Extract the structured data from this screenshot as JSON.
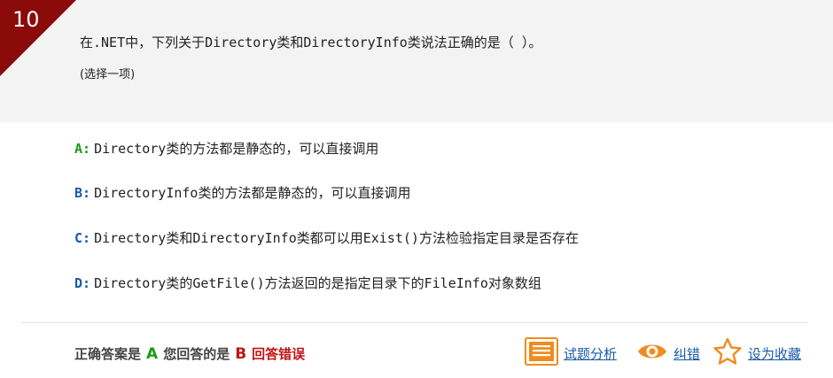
{
  "question": {
    "number": "10",
    "text": "在.NET中，下列关于Directory类和DirectoryInfo类说法正确的是（ ）。",
    "type": "(选择一项)"
  },
  "options": [
    {
      "key": "A:",
      "text": "Directory类的方法都是静态的，可以直接调用",
      "key_color": "#1a9a1a"
    },
    {
      "key": "B:",
      "text": "DirectoryInfo类的方法都是静态的，可以直接调用",
      "key_color": "#1a5aa8"
    },
    {
      "key": "C:",
      "text": "Directory类和DirectoryInfo类都可以用Exist()方法检验指定目录是否存在",
      "key_color": "#1a5aa8"
    },
    {
      "key": "D:",
      "text": "Directory类的GetFile()方法返回的是指定目录下的FileInfo对象数组",
      "key_color": "#1a5aa8"
    }
  ],
  "result": {
    "correct_prefix": "正确答案是",
    "correct_answer": "A",
    "given_prefix": "您回答的是",
    "given_answer": "B",
    "verdict": "回答错误"
  },
  "actions": {
    "analysis": {
      "label": "试题分析",
      "icon": "document-list-icon"
    },
    "report": {
      "label": "纠错",
      "icon": "eye-icon"
    },
    "favorite": {
      "label": "设为收藏",
      "icon": "star-icon"
    }
  },
  "colors": {
    "badge": "#8b0a0a",
    "correct": "#1a9a1a",
    "wrong": "#c01414",
    "link": "#1a5aa8",
    "icon_orange": "#f08c1e"
  }
}
